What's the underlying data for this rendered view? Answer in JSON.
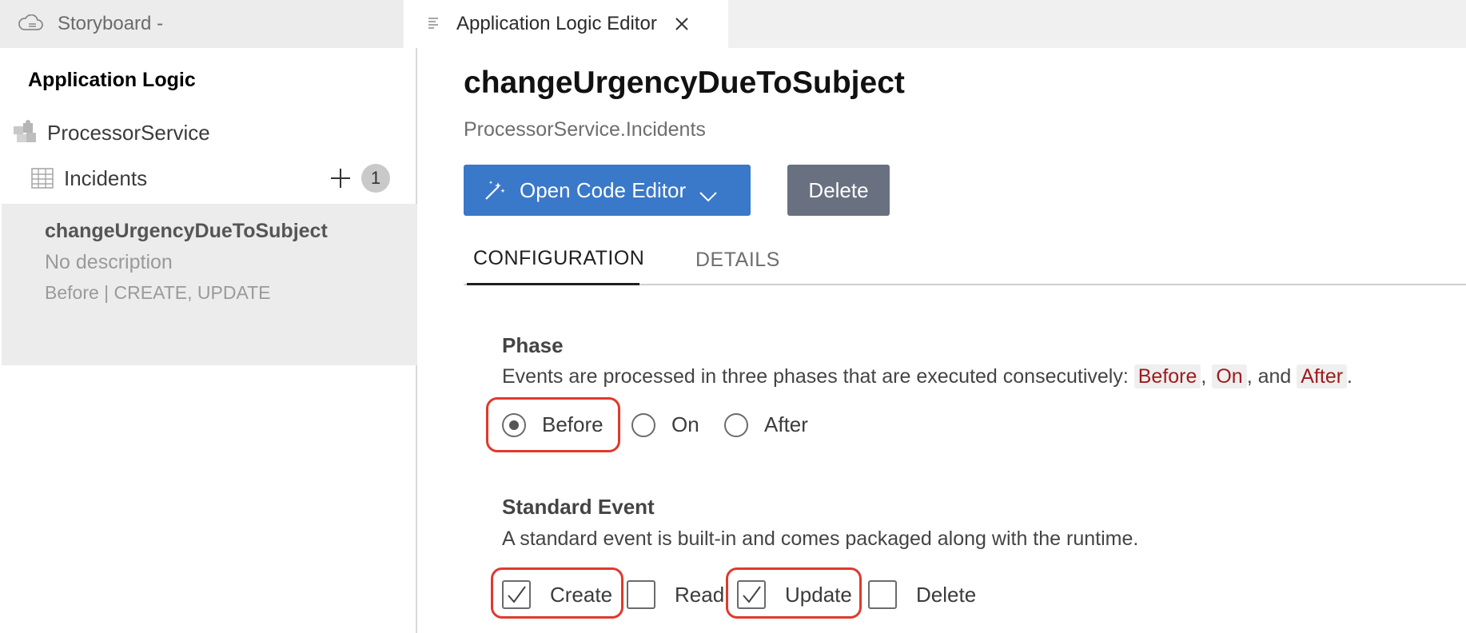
{
  "tabs": {
    "storyboard_label": "Storyboard -",
    "editor_label": "Application Logic Editor"
  },
  "sidebar": {
    "title": "Application Logic",
    "service": "ProcessorService",
    "entity": "Incidents",
    "entity_count": "1",
    "item": {
      "name": "changeUrgencyDueToSubject",
      "description": "No description",
      "events": "Before | CREATE, UPDATE"
    }
  },
  "main": {
    "title": "changeUrgencyDueToSubject",
    "subtitle": "ProcessorService.Incidents",
    "open_editor_label": "Open Code Editor",
    "delete_label": "Delete",
    "tabs": [
      {
        "label": "CONFIGURATION",
        "active": true
      },
      {
        "label": "DETAILS",
        "active": false
      }
    ],
    "phase": {
      "heading": "Phase",
      "desc_prefix": "Events are processed in three phases that are executed consecutively: ",
      "code_before": "Before",
      "sep1": ",",
      "code_on": "On",
      "sep2": ", and",
      "code_after": "After",
      "end": ".",
      "options": [
        {
          "label": "Before",
          "selected": true
        },
        {
          "label": "On",
          "selected": false
        },
        {
          "label": "After",
          "selected": false
        }
      ]
    },
    "standard_event": {
      "heading": "Standard Event",
      "desc": "A standard event is built-in and comes packaged along with the runtime.",
      "options": [
        {
          "label": "Create",
          "checked": true
        },
        {
          "label": "Read",
          "checked": false
        },
        {
          "label": "Update",
          "checked": true
        },
        {
          "label": "Delete",
          "checked": false
        }
      ]
    }
  },
  "colors": {
    "accent": "#3a78c9",
    "secondary_button": "#697180",
    "highlight": "#e0392b",
    "code_text": "#9e1b1b"
  },
  "icons": [
    "cloud-storyboard-icon",
    "editor-lines-icon",
    "close-icon",
    "puzzle-icon",
    "table-icon",
    "plus-icon",
    "magic-wand-icon",
    "chevron-down-icon",
    "checkmark-icon"
  ]
}
